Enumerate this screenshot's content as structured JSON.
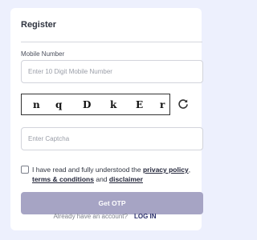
{
  "form": {
    "title": "Register",
    "mobile_label": "Mobile Number",
    "mobile_placeholder": "Enter 10 Digit Mobile Number",
    "captcha_chars": [
      "n",
      "q",
      "D",
      "k",
      "E",
      "r"
    ],
    "captcha_placeholder": "Enter Captcha",
    "refresh_icon": "refresh-icon",
    "consent_prefix": "I have read and fully understood the ",
    "privacy_link": "privacy policy",
    "comma": ",",
    "terms_link": "terms & conditions",
    "and_text": " and ",
    "disclaimer_link": "disclaimer",
    "submit_label": "Get OTP",
    "account_question": "Already have an account?",
    "login_link": "LOG IN"
  },
  "colors": {
    "page_background": "#edf0fd",
    "button": "#a6a4c4",
    "login_link": "#2a2f6b"
  }
}
